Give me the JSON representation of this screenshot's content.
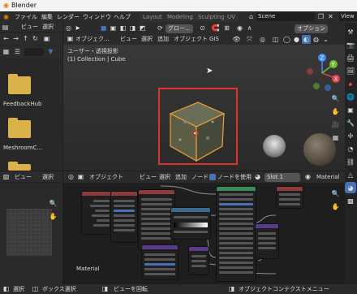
{
  "window": {
    "title": "Blender"
  },
  "menubar": {
    "items": [
      "ファイル",
      "編集",
      "レンダー",
      "ウィンドウ",
      "ヘルプ"
    ],
    "workspaces": [
      "Layout",
      "Modeling",
      "Sculpting",
      "UV"
    ],
    "scene": "Scene",
    "view_layer": "View"
  },
  "file_browser": {
    "view_label": "ビュー",
    "select_label": "選択",
    "folders": [
      "FeedbackHub",
      "MeshroomC..."
    ]
  },
  "viewport": {
    "mode": "オブジェク...",
    "menu": [
      "ビュー",
      "選択",
      "追加",
      "オブジェクト",
      "GIS"
    ],
    "orientation": "グロー...",
    "options": "オプション",
    "view_name": "ユーザー・透視投影",
    "collection_info": "(1) Collection | Cube",
    "gizmo_labels": [
      "Z",
      "Y",
      "X"
    ]
  },
  "image_panel": {
    "view_label": "ビュー",
    "select_label": "選択"
  },
  "node_editor": {
    "mode": "オブジェクト",
    "menu": [
      "ビュー",
      "選択",
      "追加",
      "ノード"
    ],
    "use_nodes": "ノードを使用",
    "slot": "Slot 1",
    "material_name": "Material",
    "label": "Material"
  },
  "statusbar": {
    "items": [
      "選択",
      "ボックス選択",
      "ビューを回転",
      "オブジェクトコンテクストメニュー"
    ]
  },
  "colors": {
    "accent": "#4772b3",
    "selection_frame": "#e03030",
    "cube_outline": "#f0a030",
    "folder": "#d9b24a"
  }
}
